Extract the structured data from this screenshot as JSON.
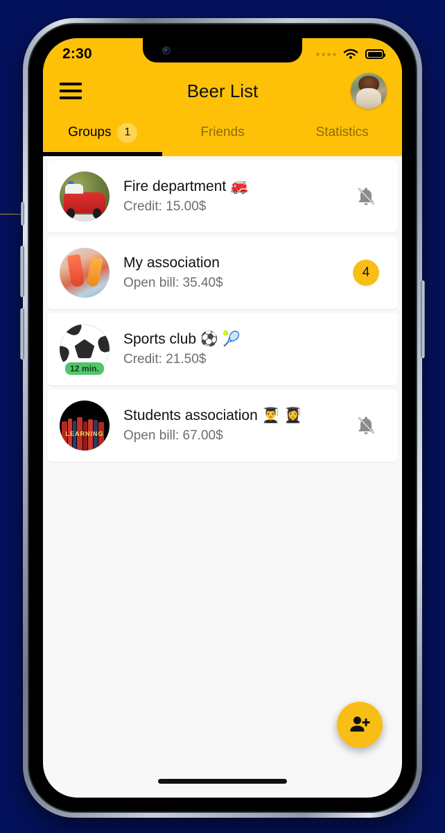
{
  "status_bar": {
    "time": "2:30",
    "signal_icon": "signal-dots-icon",
    "wifi_icon": "wifi-icon",
    "battery_icon": "battery-full-icon"
  },
  "app_bar": {
    "menu_icon": "hamburger-menu-icon",
    "title": "Beer List",
    "avatar_icon": "user-avatar"
  },
  "tabs": [
    {
      "label": "Groups",
      "badge": "1",
      "active": true
    },
    {
      "label": "Friends",
      "badge": null,
      "active": false
    },
    {
      "label": "Statistics",
      "badge": null,
      "active": false
    }
  ],
  "groups": [
    {
      "name": "Fire department 🚒",
      "balance_label": "Credit: 15.00$",
      "avatar_icon": "fire-truck-avatar",
      "trailing_type": "bell-off-icon",
      "trailing_value": null,
      "time_badge": null
    },
    {
      "name": "My association",
      "balance_label": "Open bill: 35.40$",
      "avatar_icon": "drinks-cheers-avatar",
      "trailing_type": "count-badge",
      "trailing_value": "4",
      "time_badge": null
    },
    {
      "name": "Sports club ⚽ 🎾",
      "balance_label": "Credit: 21.50$",
      "avatar_icon": "soccer-ball-avatar",
      "trailing_type": "none",
      "trailing_value": null,
      "time_badge": "12 min."
    },
    {
      "name": "Students association 👨‍🎓 👩‍🎓",
      "balance_label": "Open bill: 67.00$",
      "avatar_icon": "books-learning-avatar",
      "trailing_type": "bell-off-icon",
      "trailing_value": null,
      "time_badge": null
    }
  ],
  "fab": {
    "icon": "person-add-icon"
  },
  "colors": {
    "accent_yellow": "#FFC107",
    "badge_amber": "#F9BE15",
    "tab_badge_yellow": "#FFD450",
    "time_badge_green": "#52C46A",
    "screen_background": "#F8F8F8",
    "card_background": "#FFFFFF",
    "subtitle_gray": "#6D6D6D",
    "backdrop_navy": "#04125E"
  }
}
